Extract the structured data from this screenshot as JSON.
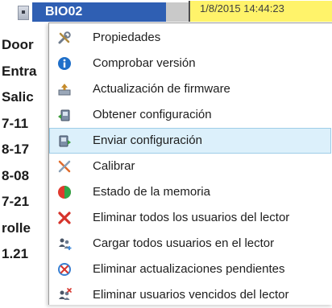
{
  "background": {
    "device_name": "BIO02",
    "timestamp": "1/8/2015 14:44:23",
    "left_column": [
      "Door",
      "Entra",
      "Salic",
      "7-11",
      "8-17",
      "8-08",
      "7-21",
      "rolle",
      "1.21"
    ]
  },
  "context_menu": {
    "items": [
      {
        "label": "Propiedades",
        "icon": "tools-icon",
        "highlighted": false
      },
      {
        "label": "Comprobar versión",
        "icon": "info-icon",
        "highlighted": false
      },
      {
        "label": "Actualización de firmware",
        "icon": "firmware-update-icon",
        "highlighted": false
      },
      {
        "label": "Obtener configuración",
        "icon": "get-config-icon",
        "highlighted": false
      },
      {
        "label": "Enviar configuración",
        "icon": "send-config-icon",
        "highlighted": true
      },
      {
        "label": "Calibrar",
        "icon": "calibrate-icon",
        "highlighted": false
      },
      {
        "label": "Estado de la memoria",
        "icon": "memory-status-icon",
        "highlighted": false
      },
      {
        "label": "Eliminar todos los usuarios del lector",
        "icon": "delete-users-icon",
        "highlighted": false
      },
      {
        "label": "Cargar todos usuarios en el lector",
        "icon": "load-users-icon",
        "highlighted": false
      },
      {
        "label": "Eliminar actualizaciones pendientes",
        "icon": "delete-pending-icon",
        "highlighted": false
      },
      {
        "label": "Eliminar usuarios vencidos del lector",
        "icon": "delete-expired-users-icon",
        "highlighted": false
      }
    ]
  },
  "colors": {
    "device_name_bg": "#2f5fb3",
    "timestamp_bg": "#fff36a",
    "highlight_bg": "#dcf0fb",
    "highlight_border": "#9ecde8"
  }
}
